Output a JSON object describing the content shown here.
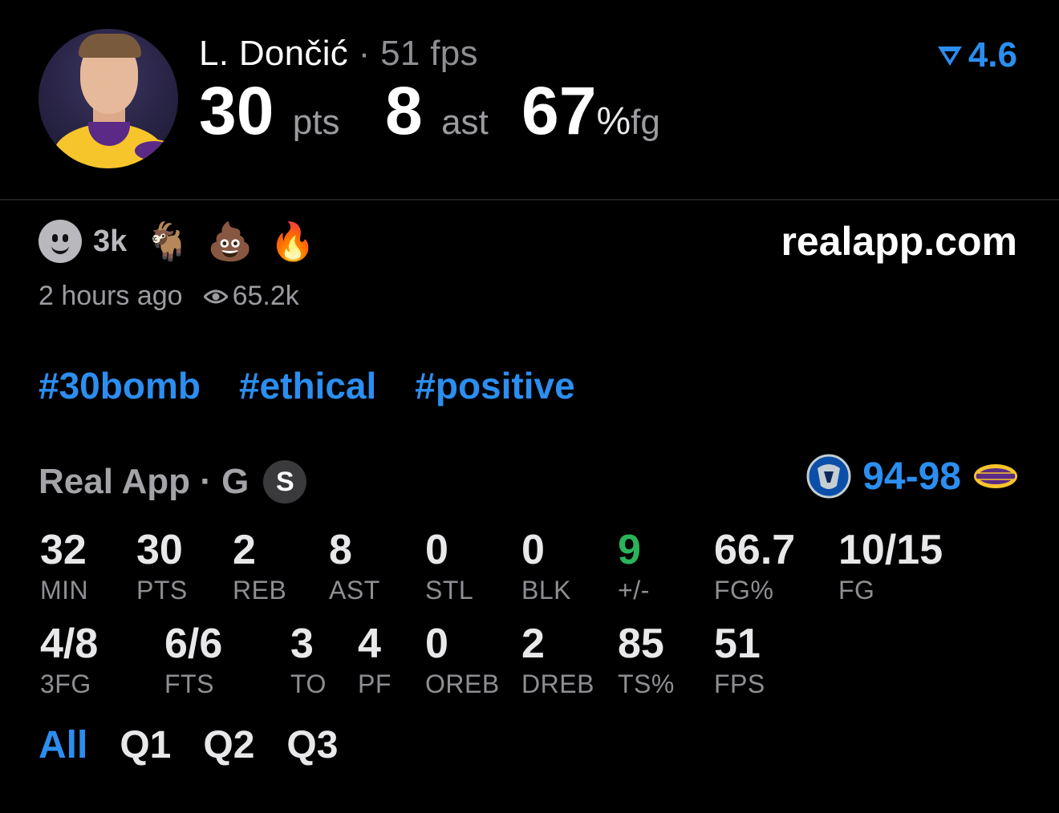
{
  "player": {
    "name": "L. Dončić",
    "fps_line": " · 51 fps",
    "pts": "30",
    "pts_unit": "pts",
    "ast": "8",
    "ast_unit": "ast",
    "fg": "67",
    "fg_pct_sign": "%",
    "fg_unit": "fg",
    "rating": "4.6",
    "avatar_icon": "player-headshot"
  },
  "reactions": {
    "count": "3k",
    "items": [
      {
        "icon": "goat-icon",
        "glyph": "🐐"
      },
      {
        "icon": "poop-icon",
        "glyph": "💩"
      },
      {
        "icon": "fire-icon",
        "glyph": "🔥"
      }
    ],
    "site": "realapp.com",
    "time_ago": "2 hours ago",
    "views": "65.2k"
  },
  "hashtags": [
    "#30bomb",
    "#ethical",
    "#positive"
  ],
  "game": {
    "source": "Real App · G",
    "badge": "S",
    "score": "94-98"
  },
  "stats_row1": [
    {
      "value": "32",
      "label": "MIN"
    },
    {
      "value": "30",
      "label": "PTS"
    },
    {
      "value": "2",
      "label": "REB"
    },
    {
      "value": "8",
      "label": "AST"
    },
    {
      "value": "0",
      "label": "STL"
    },
    {
      "value": "0",
      "label": "BLK"
    },
    {
      "value": "9",
      "label": "+/-"
    },
    {
      "value": "66.7",
      "label": "FG%"
    },
    {
      "value": "10/15",
      "label": "FG"
    }
  ],
  "stats_row2": [
    {
      "value": "4/8",
      "label": "3FG"
    },
    {
      "value": "6/6",
      "label": "FTS"
    },
    {
      "value": "3",
      "label": "TO"
    },
    {
      "value": "4",
      "label": "PF"
    },
    {
      "value": "0",
      "label": "OREB"
    },
    {
      "value": "2",
      "label": "DREB"
    },
    {
      "value": "85",
      "label": "TS%"
    },
    {
      "value": "51",
      "label": "FPS"
    }
  ],
  "tabs": [
    "All",
    "Q1",
    "Q2",
    "Q3"
  ],
  "colors": {
    "accent": "#2b8ef0",
    "positive": "#2bb35a",
    "background": "#000000"
  }
}
